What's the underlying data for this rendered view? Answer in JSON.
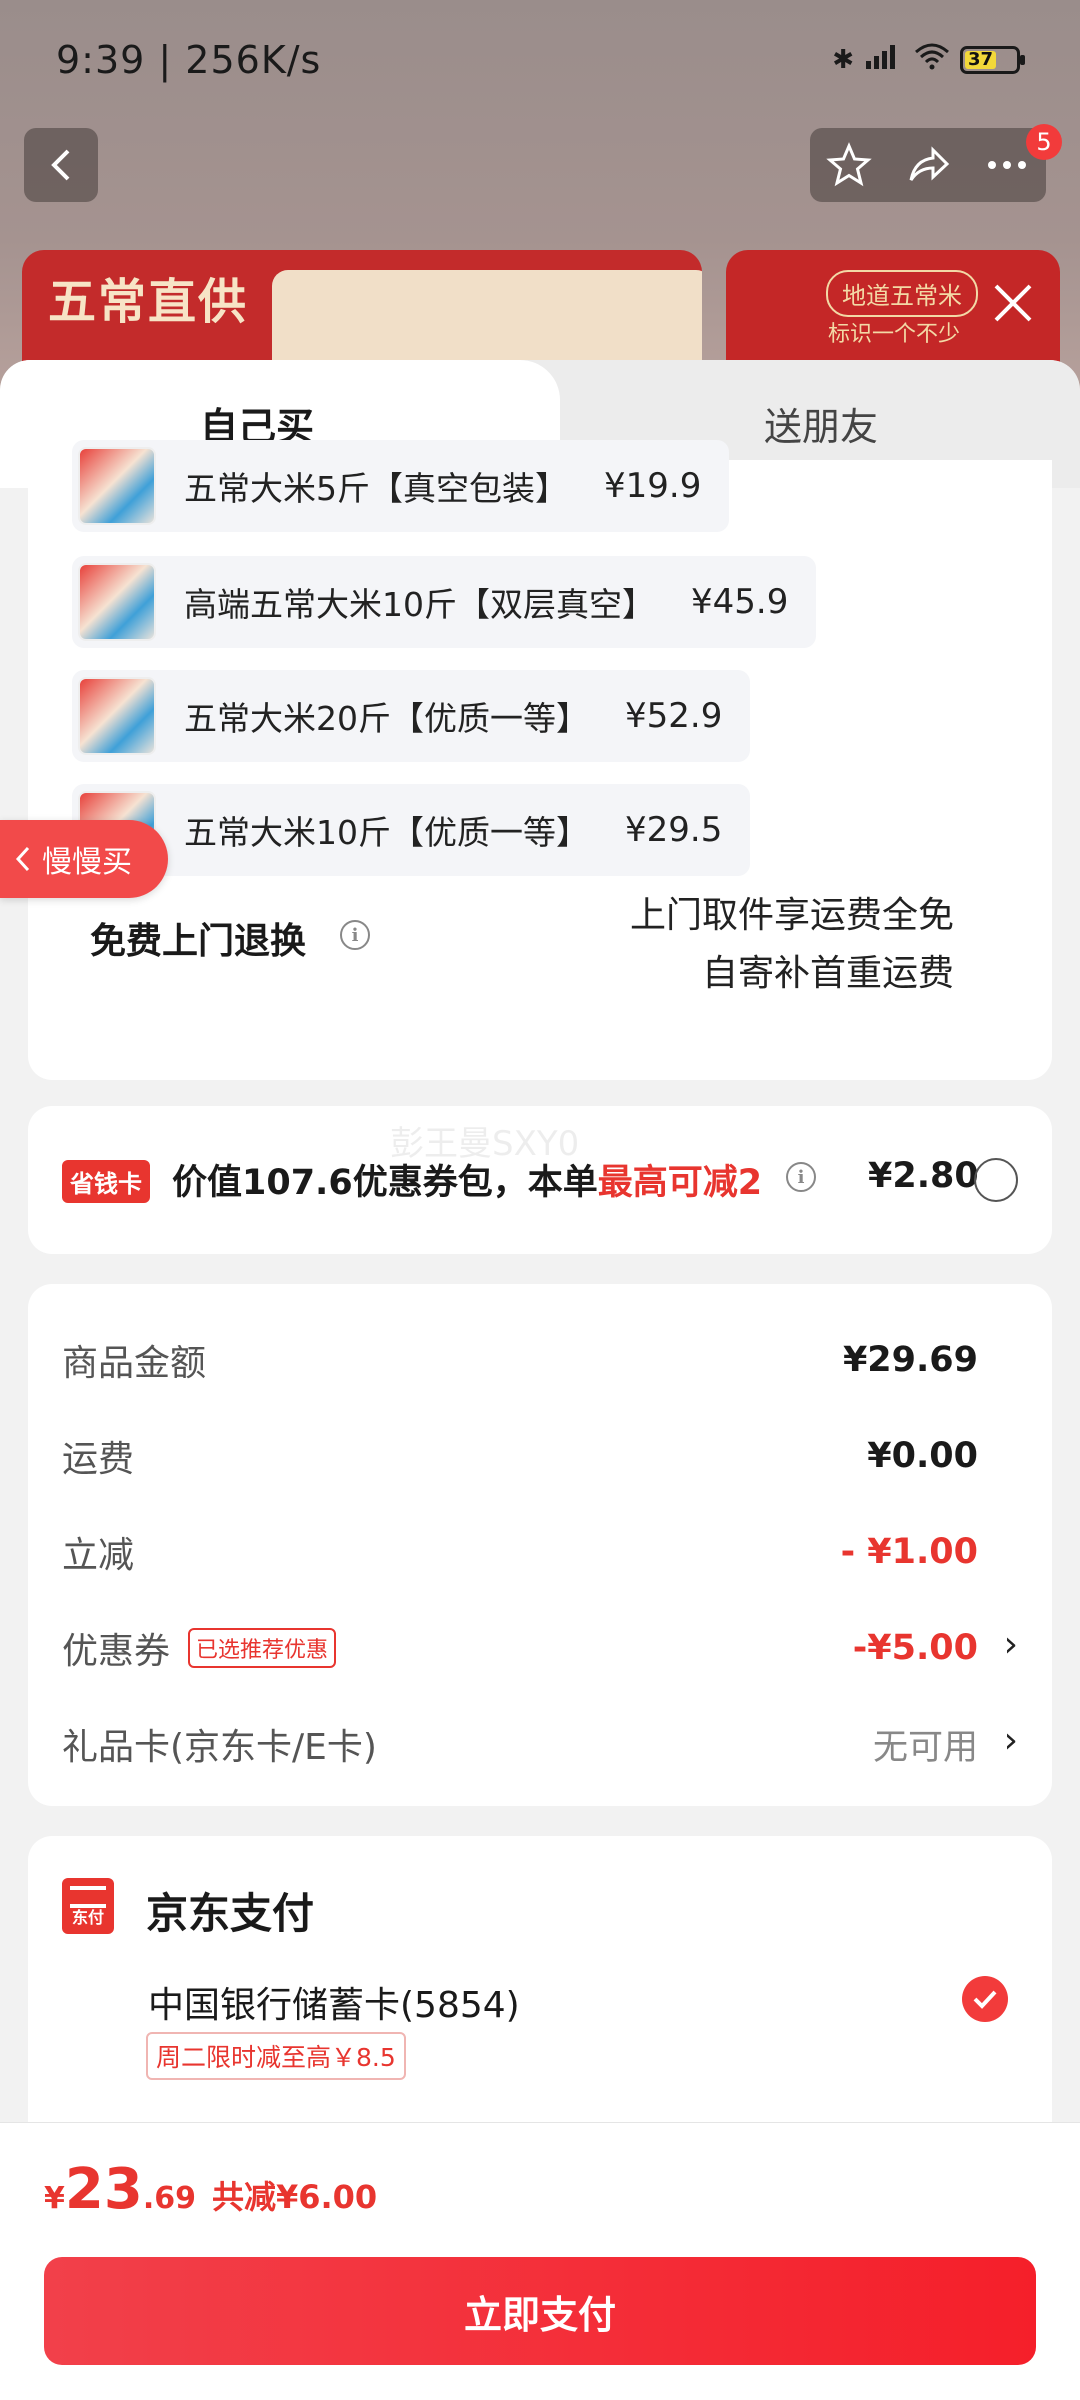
{
  "status_bar": {
    "time": "9:39 | 256K/s",
    "battery": "37"
  },
  "nav": {
    "badge_count": "5"
  },
  "banner": {
    "left_title": "五常直供",
    "right_pill": "地道五常米",
    "right_sub": "标识一个不少"
  },
  "tabs": [
    {
      "label": "自己买"
    },
    {
      "label": "送朋友"
    }
  ],
  "products": [
    {
      "name": "五常大米5斤【真空包装】",
      "price": "¥19.9"
    },
    {
      "name": "高端五常大米10斤【双层真空】",
      "price": "¥45.9"
    },
    {
      "name": "五常大米20斤【优质一等】",
      "price": "¥52.9"
    },
    {
      "name": "五常大米10斤【优质一等】",
      "price": "¥29.5"
    }
  ],
  "slow_buy_label": "慢慢买",
  "returns": {
    "title": "免费上门退换",
    "line1": "上门取件享运费全免",
    "line2": "自寄补首重运费"
  },
  "saver": {
    "tag": "省钱卡",
    "text_main": "价值107.6优惠券包，本单",
    "text_highlight": "最高可减2",
    "price": "¥2.80",
    "watermark": "彭王曼SXY0"
  },
  "amounts": {
    "goods_label": "商品金额",
    "goods_value": "¥29.69",
    "shipping_label": "运费",
    "shipping_value": "¥0.00",
    "discount_label": "立减",
    "discount_value": "- ¥1.00",
    "coupon_label": "优惠券",
    "coupon_tag": "已选推荐优惠",
    "coupon_value": "-¥5.00",
    "giftcard_label": "礼品卡(京东卡/E卡)",
    "giftcard_value": "无可用"
  },
  "payment": {
    "logo_text": "东付",
    "title": "京东支付",
    "bank": "中国银行储蓄卡(5854)",
    "promo": "周二限时减至高￥8.5"
  },
  "bottom": {
    "currency": "¥",
    "total_int": "23",
    "total_dec": ".69",
    "saved": "共减¥6.00",
    "pay_button": "立即支付"
  }
}
